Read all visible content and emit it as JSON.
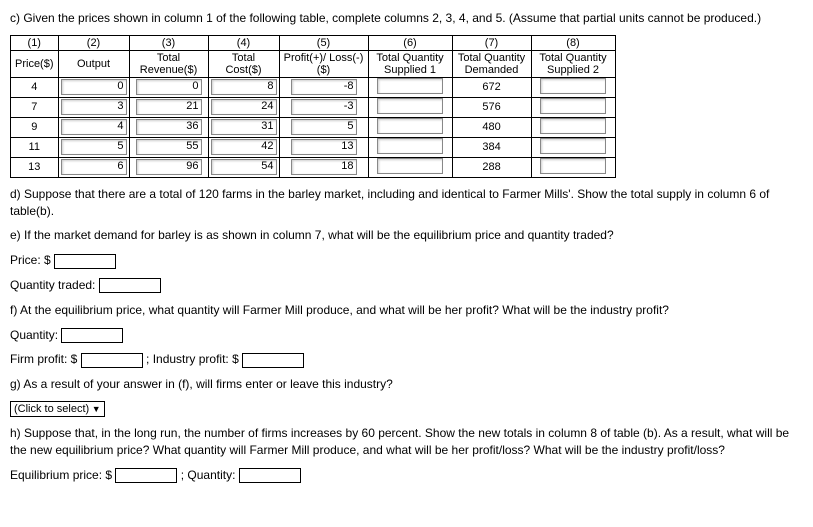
{
  "intro": "c) Given the prices shown in column 1 of the following table, complete columns 2, 3, 4, and 5. (Assume that partial units cannot be produced.)",
  "table": {
    "colnums": [
      "(1)",
      "(2)",
      "(3)",
      "(4)",
      "(5)",
      "(6)",
      "(7)",
      "(8)"
    ],
    "headers": [
      "Price($)",
      "Output",
      "Total Revenue($)",
      "Total Cost($)",
      "Profit(+)/ Loss(-)($)",
      "Total Quantity Supplied 1",
      "Total Quantity Demanded",
      "Total Quantity Supplied 2"
    ],
    "rows": [
      {
        "price": "4",
        "output": "0",
        "rev": "0",
        "cost": "8",
        "pl": "-8",
        "demand": "672"
      },
      {
        "price": "7",
        "output": "3",
        "rev": "21",
        "cost": "24",
        "pl": "-3",
        "demand": "576"
      },
      {
        "price": "9",
        "output": "4",
        "rev": "36",
        "cost": "31",
        "pl": "5",
        "demand": "480"
      },
      {
        "price": "11",
        "output": "5",
        "rev": "55",
        "cost": "42",
        "pl": "13",
        "demand": "384"
      },
      {
        "price": "13",
        "output": "6",
        "rev": "96",
        "cost": "54",
        "pl": "18",
        "demand": "288"
      }
    ]
  },
  "q_d": "d) Suppose that there are a total of 120 farms in the barley market, including and identical to Farmer Mills'. Show the total supply in column 6 of table(b).",
  "q_e": "e) If the market demand for barley is as shown in column 7, what will be the equilibrium price and quantity traded?",
  "price_label": "Price: $",
  "qty_traded_label": "Quantity traded:",
  "q_f": "f) At the equilibrium price, what quantity will Farmer Mill produce, and what will be her profit? What will be the industry profit?",
  "qty_label": "Quantity:",
  "firm_profit_label": "Firm profit: $",
  "ind_profit_label": "; Industry profit: $",
  "q_g": "g) As a result of your answer in (f), will firms enter or leave this industry?",
  "select_placeholder": "(Click to select)",
  "q_h": "h) Suppose that, in the long run, the number of firms increases by 60 percent. Show the new totals in column 8 of table (b). As a result, what will be the new equilibrium price? What quantity will Farmer Mill produce, and what will be her profit/loss? What will be the industry profit/loss?",
  "eq_price_label": "Equilibrium price: $",
  "qty2_label": "; Quantity:"
}
